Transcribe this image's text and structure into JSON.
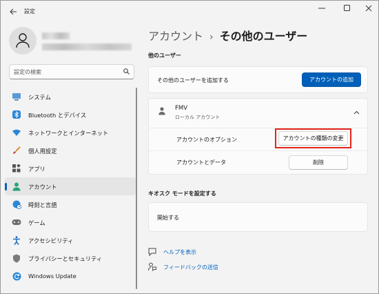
{
  "titlebar": {
    "back_icon": "back-arrow-icon",
    "title": "設定",
    "controls": [
      "minimize-icon",
      "maximize-icon",
      "close-icon"
    ]
  },
  "profile": {
    "avatar_icon": "person-icon"
  },
  "search": {
    "placeholder": "設定の検索",
    "icon": "search-icon"
  },
  "sidebar": {
    "items": [
      {
        "label": "システム",
        "icon": "system-icon"
      },
      {
        "label": "Bluetooth とデバイス",
        "icon": "bluetooth-icon"
      },
      {
        "label": "ネットワークとインターネット",
        "icon": "wifi-icon"
      },
      {
        "label": "個人用設定",
        "icon": "brush-icon"
      },
      {
        "label": "アプリ",
        "icon": "apps-icon"
      },
      {
        "label": "アカウント",
        "icon": "account-icon",
        "selected": true
      },
      {
        "label": "時刻と言語",
        "icon": "globe-clock-icon"
      },
      {
        "label": "ゲーム",
        "icon": "gamepad-icon"
      },
      {
        "label": "アクセシビリティ",
        "icon": "accessibility-icon"
      },
      {
        "label": "プライバシーとセキュリティ",
        "icon": "shield-icon"
      },
      {
        "label": "Windows Update",
        "icon": "update-icon"
      }
    ]
  },
  "breadcrumb": {
    "parent": "アカウント",
    "separator": "›",
    "current": "その他のユーザー"
  },
  "other_users": {
    "heading": "他のユーザー",
    "add_text": "その他のユーザーを追加する",
    "add_button": "アカウントの追加",
    "user": {
      "name": "FMV",
      "type": "ローカル アカウント",
      "icon": "person-icon",
      "expand_icon": "chevron-up-icon"
    },
    "options_label": "アカウントのオプション",
    "change_type_button": "アカウントの種類の変更",
    "data_label": "アカウントとデータ",
    "delete_button": "削除"
  },
  "kiosk": {
    "heading": "キオスク モードを設定する",
    "start": "開始する"
  },
  "links": {
    "help": "ヘルプを表示",
    "feedback": "フィードバックの送信"
  },
  "colors": {
    "accent": "#005fb8",
    "highlight": "#e2231a",
    "link": "#0060c0"
  }
}
